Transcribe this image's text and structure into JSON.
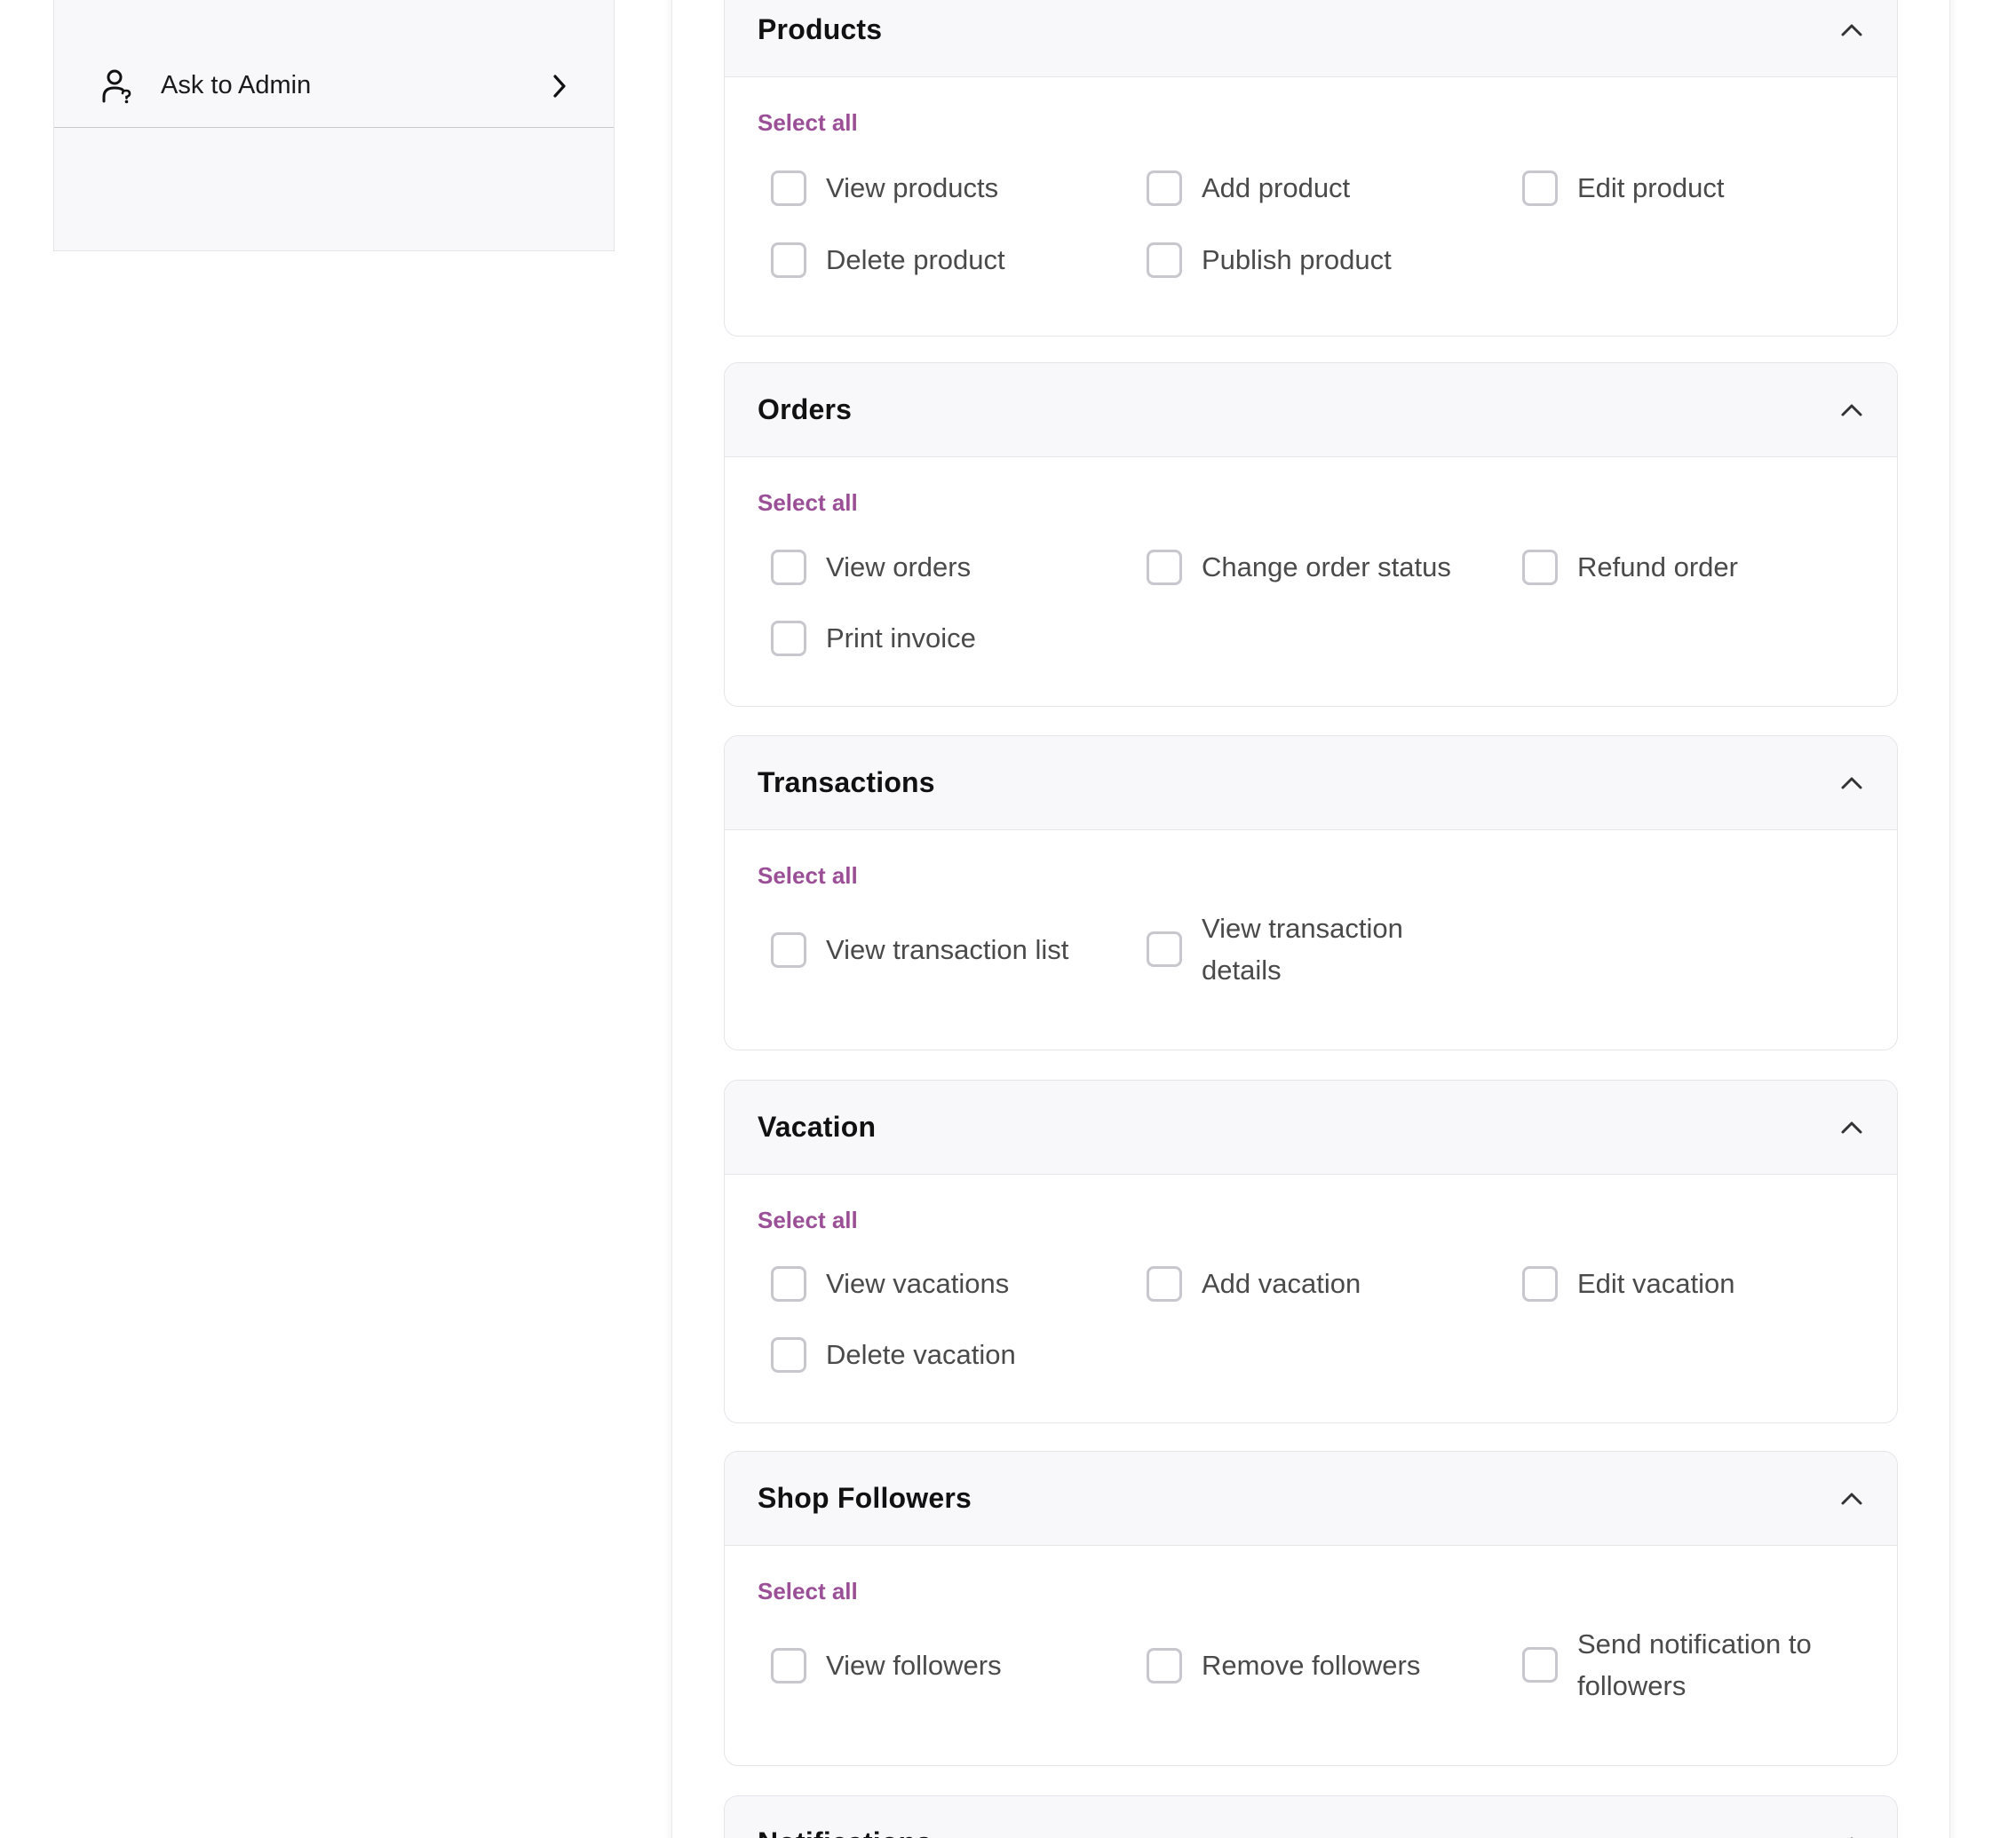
{
  "sidebar": {
    "items": [
      {
        "label": "Ask to Admin",
        "icon": "user-question-icon"
      }
    ]
  },
  "sections": [
    {
      "title": "Products",
      "select_all": "Select all",
      "options": [
        "View products",
        "Add product",
        "Edit product",
        "Delete product",
        "Publish product"
      ]
    },
    {
      "title": "Orders",
      "select_all": "Select all",
      "options": [
        "View orders",
        "Change order status",
        "Refund order",
        "Print invoice"
      ]
    },
    {
      "title": "Transactions",
      "select_all": "Select all",
      "options": [
        "View transaction list",
        "View transaction details"
      ]
    },
    {
      "title": "Vacation",
      "select_all": "Select all",
      "options": [
        "View vacations",
        "Add vacation",
        "Edit vacation",
        "Delete vacation"
      ]
    },
    {
      "title": "Shop Followers",
      "select_all": "Select all",
      "options": [
        "View followers",
        "Remove followers",
        "Send notification to followers"
      ]
    },
    {
      "title": "Notifications"
    }
  ],
  "colors": {
    "accent": "#9b4f96",
    "header_bg": "#f8f8fa",
    "border": "#e4e4e9",
    "checkbox_border": "#c7c7cd",
    "text_muted": "#4a4a4a"
  }
}
